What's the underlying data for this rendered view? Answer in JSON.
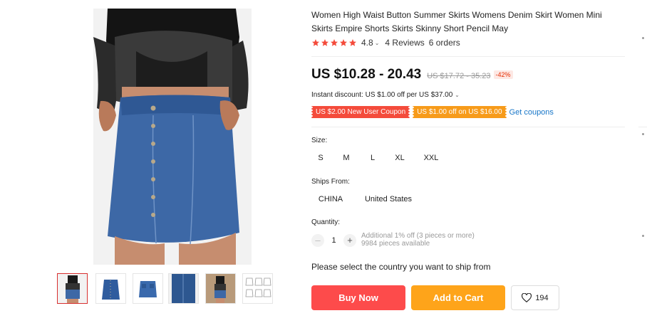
{
  "gallery": {
    "main_image": "woman-wearing-denim-mini-skirt",
    "thumbnails": [
      {
        "name": "thumb-model-front",
        "active": true
      },
      {
        "name": "thumb-skirt-front",
        "active": false
      },
      {
        "name": "thumb-skirt-back",
        "active": false
      },
      {
        "name": "thumb-skirt-closeup",
        "active": false
      },
      {
        "name": "thumb-model-side",
        "active": false
      },
      {
        "name": "thumb-size-chart",
        "active": false
      }
    ]
  },
  "product": {
    "title": "Women High Waist Button Summer Skirts Womens Denim Skirt Women Mini Skirts Empire Shorts Skirts Skinny Short Pencil May",
    "rating": "4.8",
    "stars": 5,
    "reviews": "4 Reviews",
    "orders": "6 orders",
    "price": "US $10.28 - 20.43",
    "original_price": "US $17.72 - 35.23",
    "discount": "-42%",
    "instant_discount": "Instant discount: US $1.00 off per US $37.00",
    "coupons": [
      "US $2.00 New User Coupon",
      "US $1.00 off on US $16.00"
    ],
    "get_coupons": "Get coupons"
  },
  "size": {
    "label": "Size:",
    "options": [
      "S",
      "M",
      "L",
      "XL",
      "XXL"
    ]
  },
  "ships_from": {
    "label": "Ships From:",
    "options": [
      "CHINA",
      "United States"
    ]
  },
  "quantity": {
    "label": "Quantity:",
    "value": "1",
    "minus": "–",
    "plus": "+",
    "note": "Additional 1% off (3 pieces or more)",
    "available": "9984 pieces available"
  },
  "ship_prompt": "Please select the country you want to ship from",
  "actions": {
    "buy_now": "Buy Now",
    "add_to_cart": "Add to Cart",
    "wishlist_count": "194"
  },
  "colors": {
    "price_accent": "#e62e04",
    "buy_now": "#fd4b4b",
    "add_to_cart": "#fea41a",
    "coupon_red": "#f44b3b",
    "coupon_orange": "#f79b1a",
    "link": "#1776c8",
    "star": "#f44b3b"
  }
}
